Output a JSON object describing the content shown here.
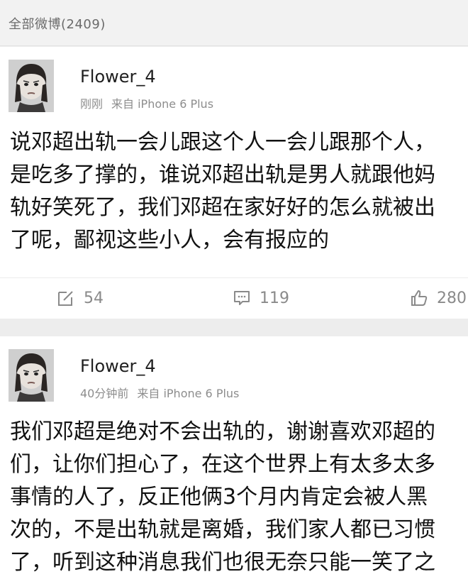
{
  "header": {
    "title": "全部微博(2409)"
  },
  "posts": [
    {
      "user": {
        "name": "Flower_4"
      },
      "meta": {
        "time": "刚刚",
        "source": "来自 iPhone 6 Plus"
      },
      "content_lines": [
        "说邓超出轨一会儿跟这个人一会儿跟那个人，",
        "是吃多了撑的，谁说邓超出轨是男人就跟他妈",
        "轨好笑死了，我们邓超在家好好的怎么就被出",
        "了呢，鄙视这些小人，会有报应的"
      ],
      "actions": {
        "repost": "54",
        "comment": "119",
        "like": "280"
      }
    },
    {
      "user": {
        "name": "Flower_4"
      },
      "meta": {
        "time": "40分钟前",
        "source": "来自 iPhone 6 Plus"
      },
      "content_lines": [
        "我们邓超是绝对不会出轨的，谢谢喜欢邓超的",
        "们，让你们担心了，在这个世界上有太多太多",
        "事情的人了，反正他俩3个月内肯定会被人黑",
        "次的，不是出轨就是离婚，我们家人都已习惯",
        "了，听到这种消息我们也很无奈只能一笑了之"
      ]
    }
  ],
  "icons": {
    "repost": "edit-square-icon",
    "comment": "comment-bubble-icon",
    "like": "thumbs-up-icon"
  },
  "colors": {
    "background": "#ededed",
    "card": "#ffffff",
    "meta_text": "#8d8d8d",
    "action_text": "#8a8a8a"
  }
}
